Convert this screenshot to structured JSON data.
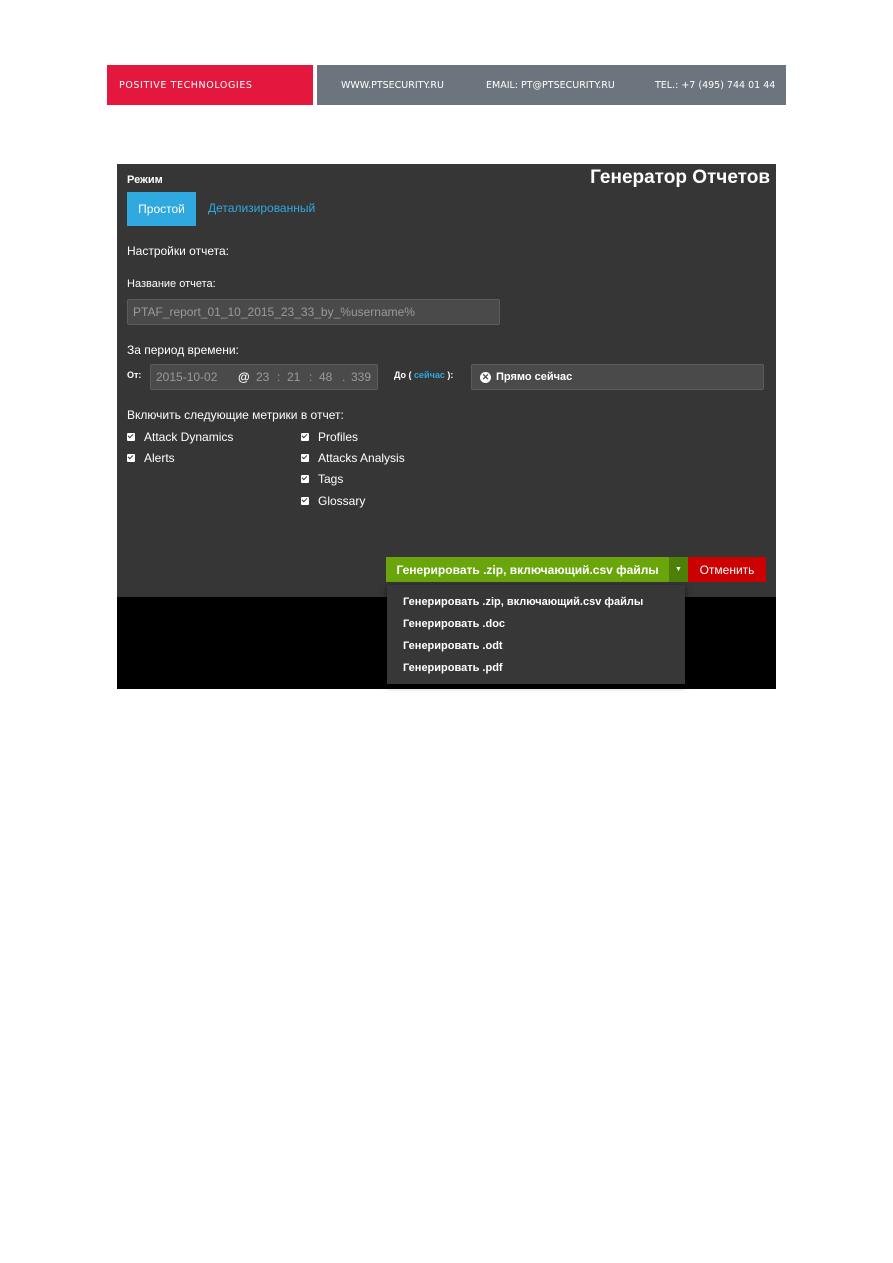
{
  "banner": {
    "brand": "POSITIVE TECHNOLOGIES",
    "website": "WWW.PTSECURITY.RU",
    "email": "EMAIL: PT@PTSECURITY.RU",
    "phone": "TEL.: +7 (495) 744 01 44",
    "brand_color": "#e4173e",
    "info_color": "#6c757d"
  },
  "report_generator": {
    "title": "Генератор Отчетов",
    "mode_label": "Режим",
    "tabs": [
      {
        "label": "Простой",
        "active": true
      },
      {
        "label": "Детализированный",
        "active": false
      }
    ],
    "settings_heading": "Настройки отчета:",
    "report_name_label": "Название отчета:",
    "report_name_value": "PTAF_report_01_10_2015_23_33_by_%username%",
    "period_label": "За период времени:",
    "from_label": "От:",
    "from": {
      "date": "2015-10-02",
      "at": "@",
      "hour": "23",
      "minute": "21",
      "second": "48",
      "ms": "339",
      "sep_colon": ":",
      "sep_dot": "."
    },
    "to_label_prefix": "До (",
    "to_link": "сейчас",
    "to_label_suffix": "):",
    "now_icon": "x-circle-icon",
    "now_button": "Прямо сейчас",
    "metrics_label": "Включить следующие метрики в отчет:",
    "metrics": [
      {
        "label": "Attack Dynamics",
        "checked": true
      },
      {
        "label": "Alerts",
        "checked": true
      },
      {
        "label": "Profiles",
        "checked": true
      },
      {
        "label": "Attacks Analysis",
        "checked": true
      },
      {
        "label": "Tags",
        "checked": true
      },
      {
        "label": "Glossary",
        "checked": true
      }
    ],
    "generate_button": "Генерировать .zip, включающий.csv файлы",
    "cancel_button": "Отменить",
    "dropdown_items": [
      "Генерировать .zip, включающий.csv файлы",
      "Генерировать .doc",
      "Генерировать .odt",
      "Генерировать .pdf"
    ],
    "colors": {
      "accent": "#2fa9e0",
      "generate": "#6aa50c",
      "cancel": "#cc0000",
      "panel": "#363636"
    }
  }
}
